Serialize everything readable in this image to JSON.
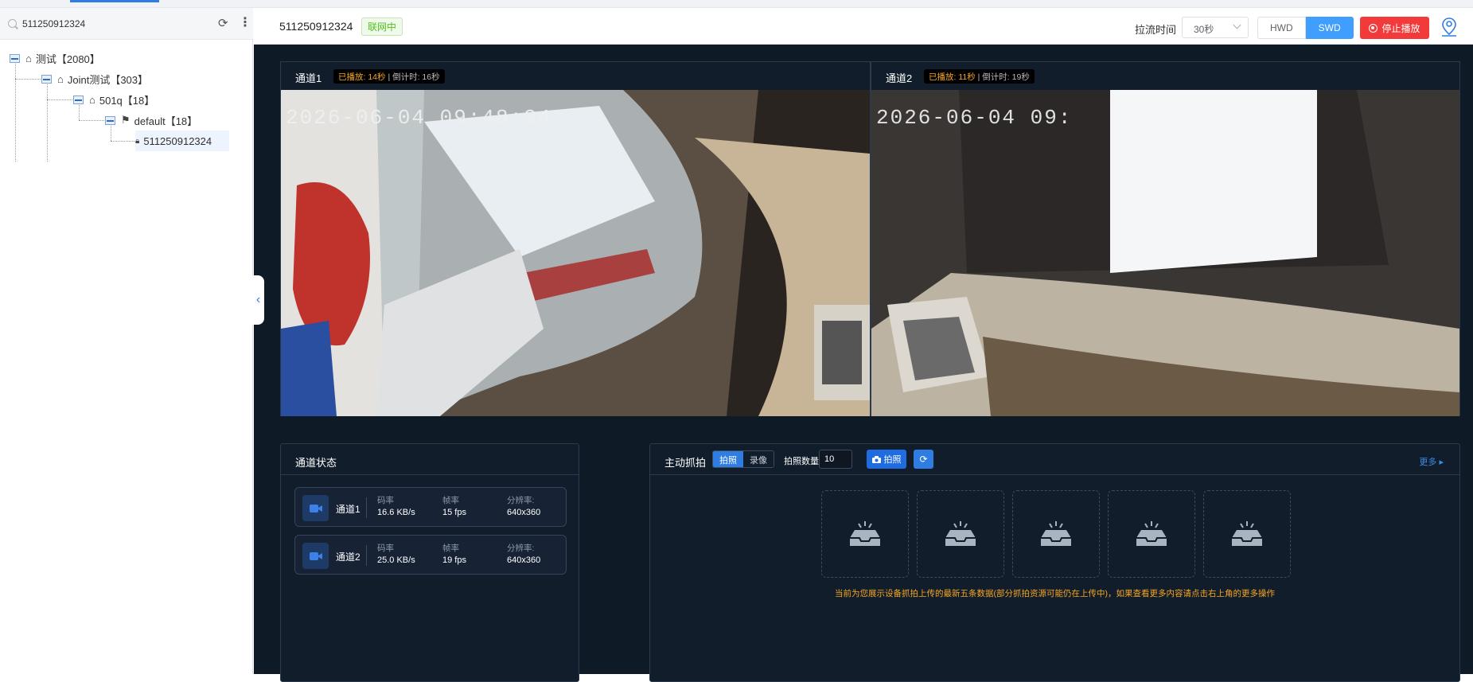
{
  "search": {
    "value": "511250912324"
  },
  "tree": [
    {
      "label": "测试【2080】",
      "icon": "home-icon"
    },
    {
      "label": "Joint测试【303】",
      "icon": "home-icon"
    },
    {
      "label": "501q【18】",
      "icon": "home-icon"
    },
    {
      "label": "default【18】",
      "icon": "flag-icon"
    },
    {
      "label": "511250912324",
      "icon": "lock-icon"
    }
  ],
  "header": {
    "device_id": "511250912324",
    "status": "联网中",
    "pull_label": "拉流时间",
    "pull_value": "30秒",
    "hwd": "HWD",
    "swd": "SWD",
    "stop": "停止播放"
  },
  "videos": [
    {
      "title": "通道1",
      "played": "已播放: 14秒",
      "countdown": "| 倒计时: 16秒",
      "timestamp": "2026-06-04 09:48:34"
    },
    {
      "title": "通道2",
      "played": "已播放: 11秒",
      "countdown": "| 倒计时: 19秒",
      "timestamp": "2026-06-04 09:"
    }
  ],
  "channel_status": {
    "title": "通道状态",
    "labels": {
      "bitrate": "码率",
      "fps": "帧率",
      "resolution": "分辨率:"
    },
    "rows": [
      {
        "name": "通道1",
        "bitrate": "16.6 KB/s",
        "fps": "15 fps",
        "resolution": "640x360"
      },
      {
        "name": "通道2",
        "bitrate": "25.0 KB/s",
        "fps": "19 fps",
        "resolution": "640x360"
      }
    ]
  },
  "snapshot": {
    "title": "主动抓拍",
    "tab_photo": "拍照",
    "tab_video": "录像",
    "count_label": "拍照数量",
    "count_value": "10",
    "capture_button": "拍照",
    "more": "更多",
    "hint": "当前为您展示设备抓拍上传的最新五条数据(部分抓拍资源可能仍在上传中)，如果查看更多内容请点击右上角的更多操作"
  },
  "colors": {
    "accent": "#409eff",
    "danger": "#f33a3a",
    "online": "#52c41a",
    "warn": "#f5a623",
    "panel_bg": "#0f1a27"
  }
}
